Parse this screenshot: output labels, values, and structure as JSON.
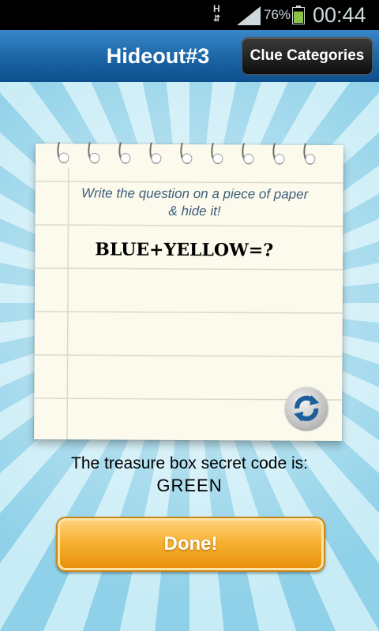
{
  "status_bar": {
    "network": "H",
    "battery_percent": "76%",
    "battery_level": 0.76,
    "time": "00:44"
  },
  "header": {
    "title": "Hideout#3",
    "clue_categories_label": "Clue Categories"
  },
  "note": {
    "instruction": "Write the question on a piece of paper & hide it!",
    "clue_text": "BLUE+YELLOW=?",
    "refresh_icon": "refresh-icon"
  },
  "code": {
    "label": "The treasure box secret code is:",
    "value": "GREEN"
  },
  "actions": {
    "done_label": "Done!"
  },
  "colors": {
    "header_blue": "#1f6aab",
    "button_orange": "#f6b233",
    "battery_green": "#8bc34a",
    "paper": "#fbfaec"
  }
}
